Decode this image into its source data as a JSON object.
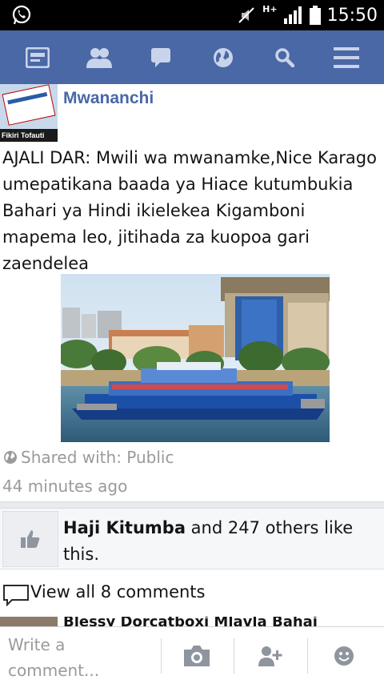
{
  "status_bar": {
    "network": "H+",
    "time": "15:50",
    "icons": [
      "whatsapp-icon",
      "muted-icon",
      "signal-icon",
      "battery-icon"
    ]
  },
  "nav": {
    "icons": [
      "news-feed-icon",
      "friends-icon",
      "messages-icon",
      "notifications-globe-icon",
      "search-icon",
      "menu-icon"
    ],
    "color": "#4a67a6"
  },
  "post": {
    "page_name": "Mwananchi",
    "avatar_caption": "Fikiri Tofauti",
    "text": "AJALI DAR: Mwili wa mwanamke,Nice Karago umepatikana baada ya Hiace kutumbukia Bahari ya Hindi ikielekea Kigamboni mapema leo, jitihada za kuopoa gari zaendelea",
    "photo_icon": "ferry-photo",
    "shared_with": "Shared with: Public",
    "time_ago": "44 minutes ago"
  },
  "likes": {
    "name": "Haji Kitumba",
    "rest": " and 247 others like this."
  },
  "comments": {
    "view_all": "View all 8 comments",
    "next_commenter": "Blessy Dorcatboxi Mlavla Bahai"
  },
  "composer": {
    "placeholder": "Write a comment...",
    "buttons": [
      "camera-icon",
      "tag-friend-icon",
      "emoji-icon"
    ]
  }
}
